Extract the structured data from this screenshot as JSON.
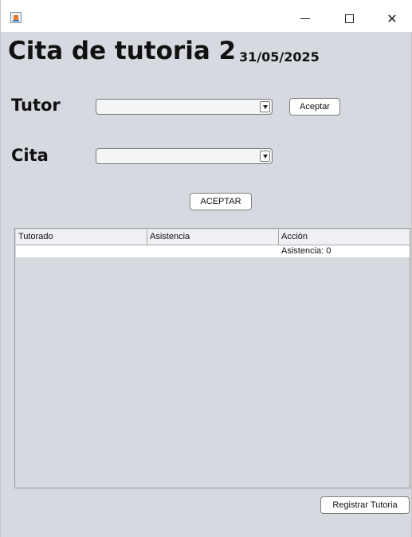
{
  "window": {
    "icon": "java-app-icon",
    "controls": {
      "minimize": "minimize-icon",
      "maximize": "maximize-icon",
      "close": "close-icon",
      "close_glyph": "✕"
    }
  },
  "header": {
    "title": "Cita de tutoria 2",
    "date": "31/05/2025"
  },
  "form": {
    "tutor_label": "Tutor",
    "tutor_value": "",
    "aceptar_label": "Aceptar",
    "cita_label": "Cita",
    "cita_value": "",
    "aceptar_main_label": "ACEPTAR"
  },
  "table": {
    "columns": [
      "Tutorado",
      "Asistencia",
      "Acción"
    ],
    "rows": [
      [
        "",
        "",
        "Asistencia: 0"
      ]
    ]
  },
  "footer": {
    "register_label": "Registrar Tutoria"
  }
}
